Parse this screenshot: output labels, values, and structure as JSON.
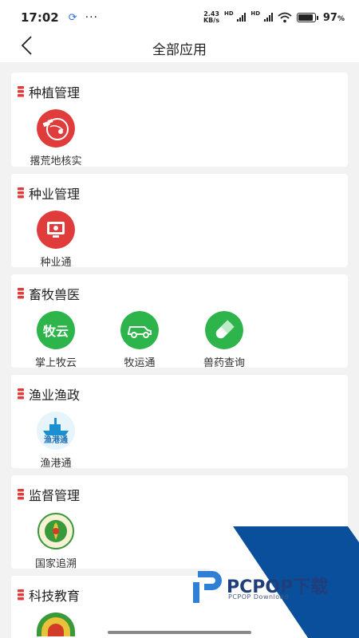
{
  "status_bar": {
    "time": "17:02",
    "more": "···",
    "speed_value": "2.43",
    "speed_unit": "KB/s",
    "hd1": "HD",
    "hd2": "HD",
    "battery": "97",
    "battery_unit": "%"
  },
  "nav": {
    "title": "全部应用"
  },
  "sections": [
    {
      "title": "种植管理",
      "apps": [
        {
          "label": "撂荒地核实",
          "icon": "satellite-map-icon"
        }
      ]
    },
    {
      "title": "种业管理",
      "apps": [
        {
          "label": "种业通",
          "icon": "monitor-icon"
        }
      ]
    },
    {
      "title": "畜牧兽医",
      "apps": [
        {
          "label": "掌上牧云",
          "icon": "muyun-logo-icon",
          "icon_text": "牧云"
        },
        {
          "label": "牧运通",
          "icon": "truck-icon"
        },
        {
          "label": "兽药查询",
          "icon": "capsule-icon"
        }
      ]
    },
    {
      "title": "渔业渔政",
      "apps": [
        {
          "label": "渔港通",
          "icon": "ship-icon",
          "icon_text": "渔港通"
        }
      ]
    },
    {
      "title": "监督管理",
      "apps": [
        {
          "label": "国家追溯",
          "icon": "trace-emblem-icon"
        }
      ]
    },
    {
      "title": "科技教育",
      "apps": []
    }
  ],
  "watermark": {
    "brand": "PCPOP下载",
    "sub": "PCPOP Download"
  },
  "colors": {
    "accent_red": "#e03c3c",
    "green": "#2db54b",
    "watermark_blue": "#0a4f9c"
  }
}
